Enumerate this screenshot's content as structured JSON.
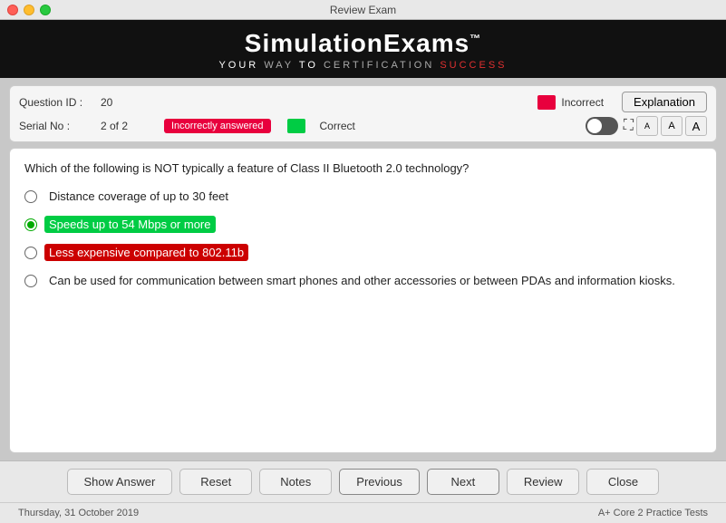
{
  "titleBar": {
    "title": "Review Exam"
  },
  "logo": {
    "main": "SimulationExams",
    "tm": "™",
    "sub_white1": "YOUR",
    "sub_normal1": " WAY ",
    "sub_white2": "TO",
    "sub_normal2": " CERTIFICATION ",
    "sub_highlight": "SUCCESS"
  },
  "info": {
    "questionIdLabel": "Question ID :",
    "questionIdValue": "20",
    "serialNoLabel": "Serial No :",
    "serialNoValue": "2 of 2",
    "incorrectLabel": "Incorrect",
    "correctLabel": "Correct",
    "incorrectlyAnsweredBadge": "Incorrectly answered",
    "explanationButton": "Explanation",
    "fontA1": "A",
    "fontA2": "A",
    "fontA3": "A"
  },
  "question": {
    "text": "Which of the following is NOT typically a feature of Class II Bluetooth 2.0 technology?",
    "options": [
      {
        "id": "a",
        "text": "Distance coverage of up to 30 feet",
        "state": "normal"
      },
      {
        "id": "b",
        "text": "Speeds up to 54 Mbps or more",
        "state": "correct"
      },
      {
        "id": "c",
        "text": "Less expensive compared to 802.11b",
        "state": "incorrect"
      },
      {
        "id": "d",
        "text": "Can be used for communication between smart phones and other accessories or between PDAs and information kiosks.",
        "state": "normal"
      }
    ]
  },
  "buttons": {
    "showAnswer": "Show Answer",
    "reset": "Reset",
    "notes": "Notes",
    "previous": "Previous",
    "next": "Next",
    "review": "Review",
    "close": "Close"
  },
  "footer": {
    "date": "Thursday, 31 October 2019",
    "product": "A+ Core 2 Practice Tests"
  }
}
